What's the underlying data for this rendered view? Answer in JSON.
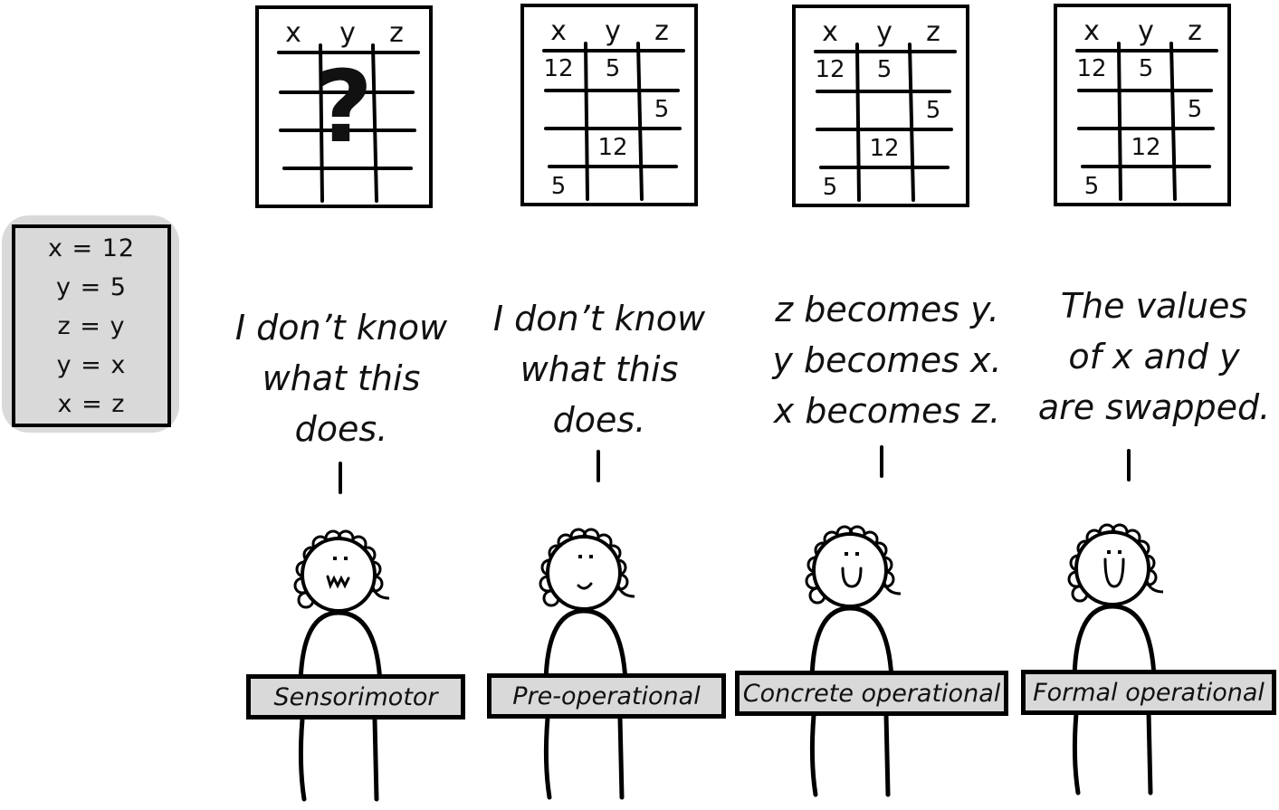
{
  "code": {
    "lines": [
      "x = 12",
      "y = 5",
      "z = y",
      "y = x",
      "x = z"
    ]
  },
  "tables": [
    {
      "headers": [
        "x",
        "y",
        "z"
      ],
      "unknown": true,
      "unknown_symbol": "?",
      "cells": []
    },
    {
      "headers": [
        "x",
        "y",
        "z"
      ],
      "unknown": false,
      "cells": [
        {
          "row": 0,
          "col": 0,
          "value": "12"
        },
        {
          "row": 0,
          "col": 1,
          "value": "5"
        },
        {
          "row": 1,
          "col": 2,
          "value": "5"
        },
        {
          "row": 2,
          "col": 1,
          "value": "12"
        },
        {
          "row": 3,
          "col": 0,
          "value": "5"
        }
      ]
    },
    {
      "headers": [
        "x",
        "y",
        "z"
      ],
      "unknown": false,
      "cells": [
        {
          "row": 0,
          "col": 0,
          "value": "12"
        },
        {
          "row": 0,
          "col": 1,
          "value": "5"
        },
        {
          "row": 1,
          "col": 2,
          "value": "5"
        },
        {
          "row": 2,
          "col": 1,
          "value": "12"
        },
        {
          "row": 3,
          "col": 0,
          "value": "5"
        }
      ]
    },
    {
      "headers": [
        "x",
        "y",
        "z"
      ],
      "unknown": false,
      "cells": [
        {
          "row": 0,
          "col": 0,
          "value": "12"
        },
        {
          "row": 0,
          "col": 1,
          "value": "5"
        },
        {
          "row": 1,
          "col": 2,
          "value": "5"
        },
        {
          "row": 2,
          "col": 1,
          "value": "12"
        },
        {
          "row": 3,
          "col": 0,
          "value": "5"
        }
      ]
    }
  ],
  "stages": [
    {
      "label": "Sensorimotor",
      "speech": [
        "I don’t know",
        "what this",
        "does."
      ],
      "expression": "worried"
    },
    {
      "label": "Pre-operational",
      "speech": [
        "I don’t know",
        "what this",
        "does."
      ],
      "expression": "slight-smile"
    },
    {
      "label": "Concrete operational",
      "speech": [
        "z becomes y.",
        "y becomes x.",
        "x becomes z."
      ],
      "expression": "smile"
    },
    {
      "label": "Formal operational",
      "speech": [
        "The values",
        "of x and y",
        "are swapped."
      ],
      "expression": "big-smile"
    }
  ]
}
